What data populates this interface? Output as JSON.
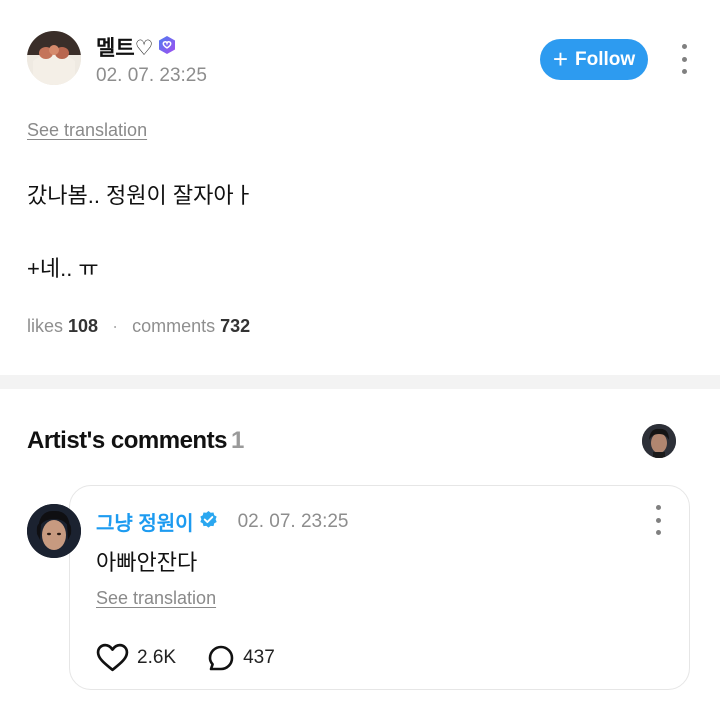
{
  "post": {
    "author_name": "멜트♡",
    "timestamp": "02. 07. 23:25",
    "follow_label": "Follow",
    "see_translation": "See translation",
    "body_line1": "갔나봄.. 정원이 잘자아ㅏ",
    "body_line2": "+네.. ㅠ",
    "likes_label": "likes",
    "likes_count": "108",
    "comments_label": "comments",
    "comments_count": "732"
  },
  "artist_comments": {
    "title": "Artist's comments",
    "count": "1"
  },
  "comment": {
    "author_name": "그냥 정원이",
    "timestamp": "02. 07. 23:25",
    "text": "아빠안잔다",
    "see_translation": "See translation",
    "like_count": "2.6K",
    "reply_count": "437"
  },
  "colors": {
    "accent": "#2d9bf0",
    "artist_name": "#1d9bf0",
    "verified_badge": "#2ba7f0",
    "membership_badge_from": "#4d7cf0",
    "membership_badge_to": "#a24ef0",
    "divider": "#f3f3f3"
  },
  "icons": [
    "membership-badge-icon",
    "plus-icon",
    "kebab-icon",
    "verified-badge-icon",
    "heart-icon",
    "comment-bubble-icon"
  ]
}
